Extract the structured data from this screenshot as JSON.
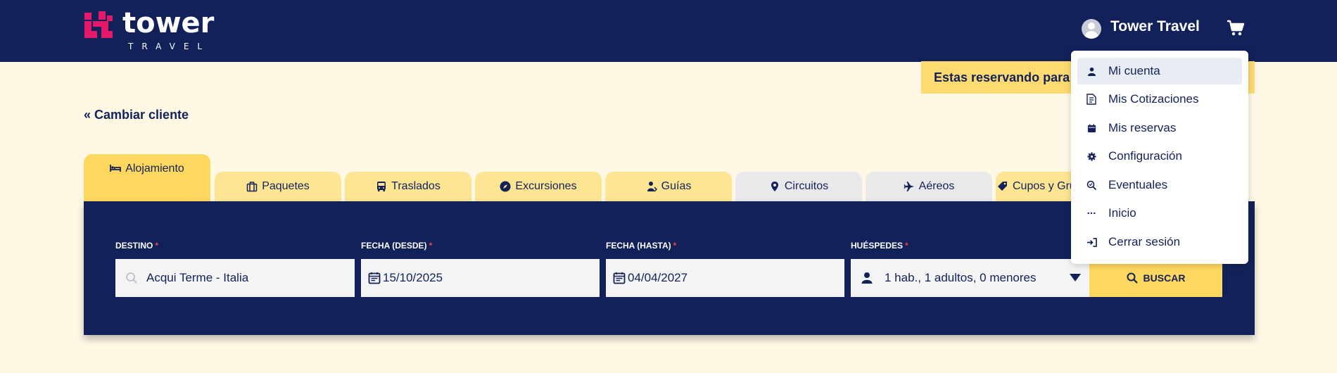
{
  "header": {
    "logo_word": "tower",
    "logo_sub": "TRAVEL",
    "user_name": "Tower Travel"
  },
  "banner": {
    "text": "Estas reservando para A"
  },
  "change_client": "« Cambiar cliente",
  "tabs": [
    {
      "label": "Alojamiento",
      "icon": "bed-icon",
      "state": "active"
    },
    {
      "label": "Paquetes",
      "icon": "briefcase-icon",
      "state": "normal"
    },
    {
      "label": "Traslados",
      "icon": "bus-icon",
      "state": "normal"
    },
    {
      "label": "Excursiones",
      "icon": "compass-icon",
      "state": "normal"
    },
    {
      "label": "Guías",
      "icon": "guide-icon",
      "state": "normal"
    },
    {
      "label": "Circuitos",
      "icon": "map-pin-icon",
      "state": "disabled"
    },
    {
      "label": "Aéreos",
      "icon": "plane-icon",
      "state": "disabled"
    },
    {
      "label": "Cupos y Grup",
      "icon": "tag-icon",
      "state": "normal"
    }
  ],
  "search": {
    "destino_label": "DESTINO",
    "destino_value": "Acqui Terme - Italia",
    "desde_label": "FECHA (DESDE)",
    "desde_value": "15/10/2025",
    "hasta_label": "FECHA (HASTA)",
    "hasta_value": "04/04/2027",
    "huespedes_label": "HUÉSPEDES",
    "huespedes_value": "1 hab., 1 adultos, 0 menores",
    "required_mark": "*",
    "button_label": "BUSCAR"
  },
  "user_menu": {
    "items": [
      {
        "label": "Mi cuenta",
        "icon": "user-icon"
      },
      {
        "label": "Mis Cotizaciones",
        "icon": "invoice-icon"
      },
      {
        "label": "Mis reservas",
        "icon": "calendar-icon"
      },
      {
        "label": "Configuración",
        "icon": "gear-icon"
      },
      {
        "label": "Eventuales",
        "icon": "search-list-icon"
      },
      {
        "label": "Inicio",
        "icon": "ellipsis-icon"
      },
      {
        "label": "Cerrar sesión",
        "icon": "logout-icon"
      }
    ]
  },
  "colors": {
    "navy": "#13215a",
    "cream": "#fef8e5",
    "yellow": "#fdd75e",
    "pink": "#e5196a"
  }
}
